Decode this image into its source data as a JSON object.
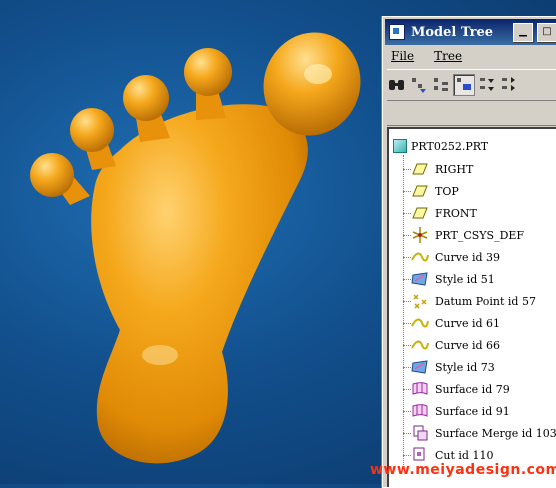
{
  "window": {
    "title": "Model Tree"
  },
  "menu": {
    "file": "File",
    "tree": "Tree"
  },
  "tree": {
    "root": "PRT0252.PRT",
    "items": [
      {
        "label": "RIGHT",
        "icon": "datum-plane-icon"
      },
      {
        "label": "TOP",
        "icon": "datum-plane-icon"
      },
      {
        "label": "FRONT",
        "icon": "datum-plane-icon"
      },
      {
        "label": "PRT_CSYS_DEF",
        "icon": "coordinate-system-icon"
      },
      {
        "label": "Curve id 39",
        "icon": "curve-icon"
      },
      {
        "label": "Style id 51",
        "icon": "style-feature-icon"
      },
      {
        "label": "Datum Point id 57",
        "icon": "datum-point-icon"
      },
      {
        "label": "Curve id 61",
        "icon": "curve-icon"
      },
      {
        "label": "Curve id 66",
        "icon": "curve-icon"
      },
      {
        "label": "Style id 73",
        "icon": "style-feature-icon"
      },
      {
        "label": "Surface id 79",
        "icon": "surface-icon"
      },
      {
        "label": "Surface id 91",
        "icon": "surface-icon"
      },
      {
        "label": "Surface Merge id 103",
        "icon": "surface-merge-icon"
      },
      {
        "label": "Cut id 110",
        "icon": "cut-icon"
      }
    ]
  },
  "watermark": "www.meiyadesign.com",
  "colors": {
    "model": "#f0a018",
    "background": "#124f8c",
    "watermark": "#ff3010"
  }
}
